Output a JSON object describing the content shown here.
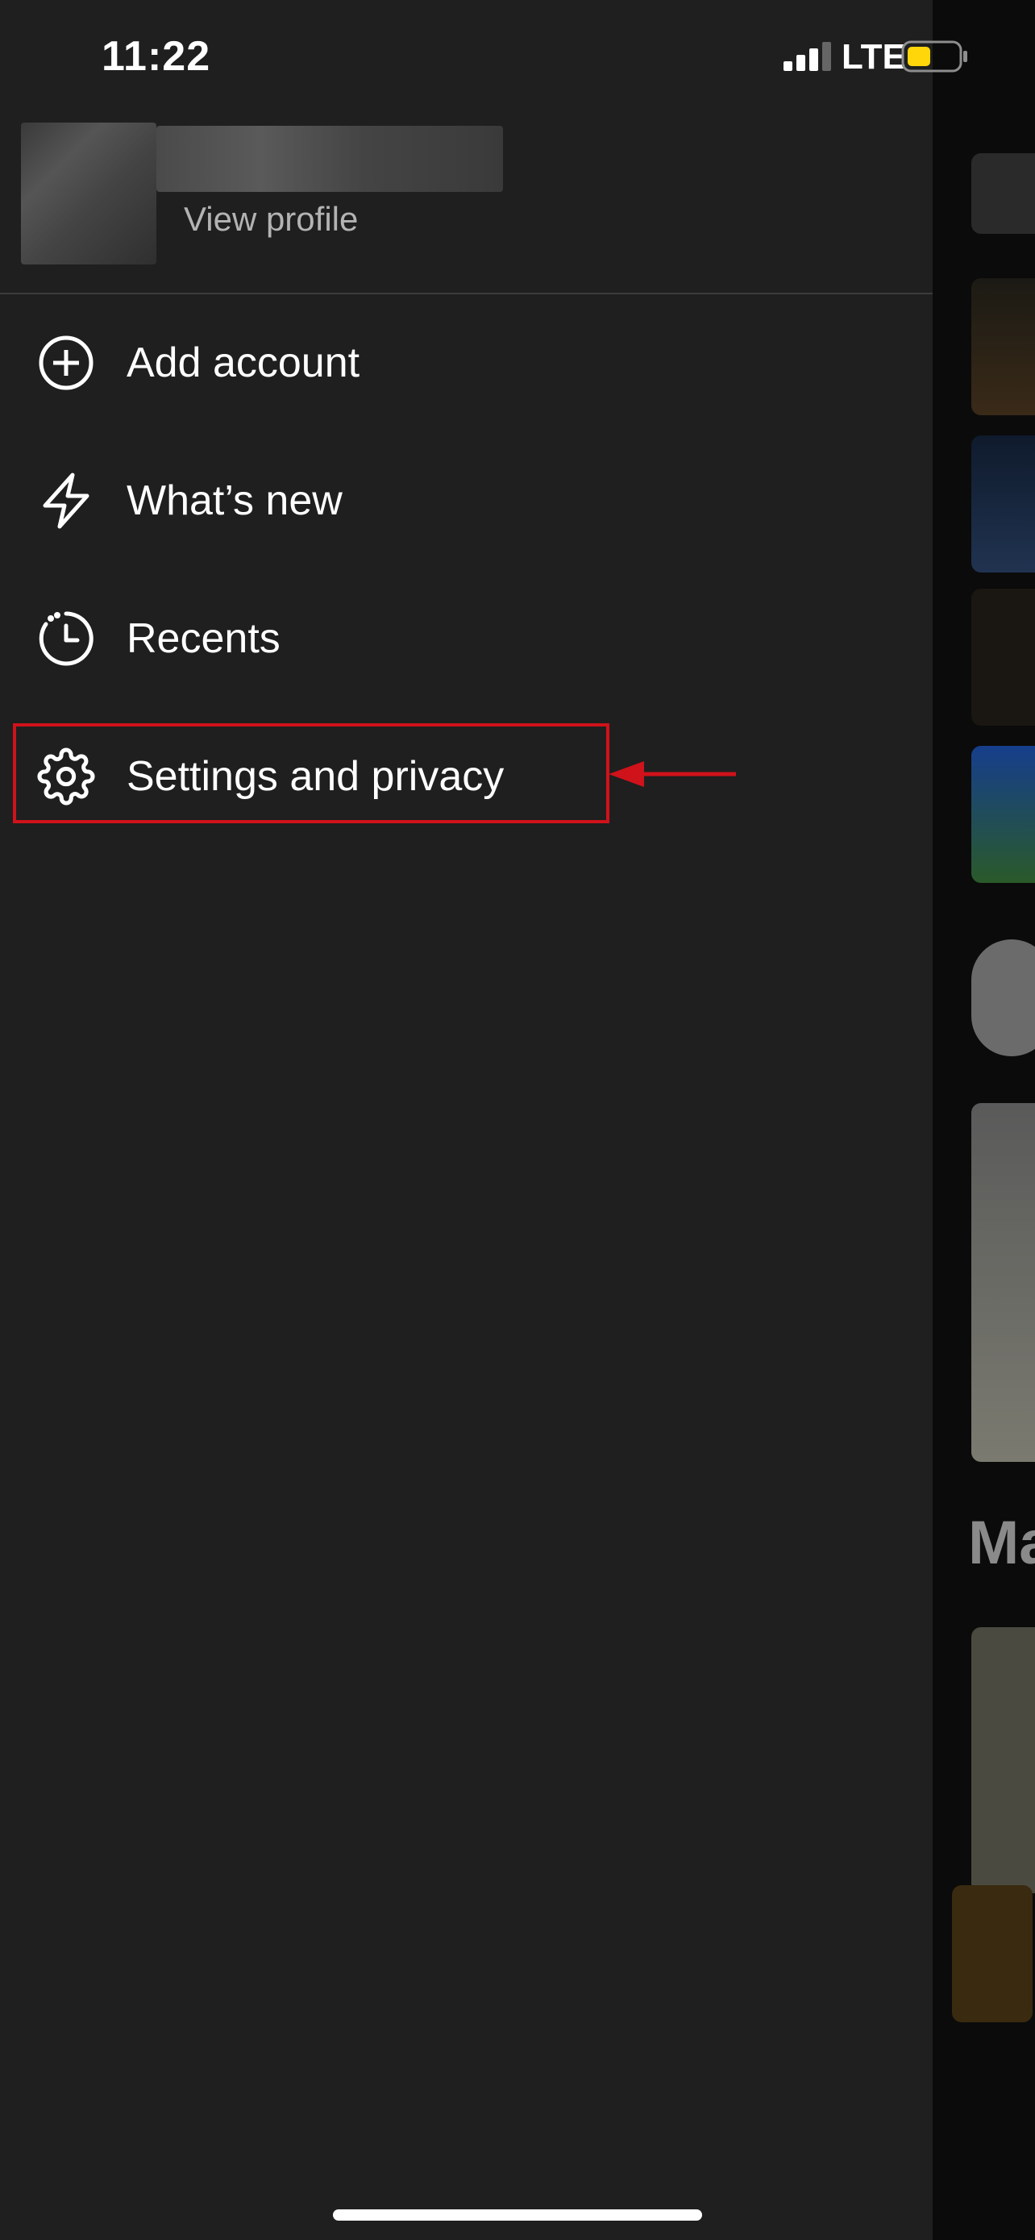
{
  "status": {
    "time": "11:22",
    "network": "LTE"
  },
  "profile": {
    "view_profile_label": "View profile"
  },
  "menu": {
    "items": [
      {
        "label": "Add account",
        "icon": "plus-circle-icon"
      },
      {
        "label": "What’s new",
        "icon": "lightning-icon"
      },
      {
        "label": "Recents",
        "icon": "clock-history-icon"
      },
      {
        "label": "Settings and privacy",
        "icon": "gear-icon"
      }
    ]
  },
  "background": {
    "section_fragment": "Ma"
  },
  "colors": {
    "background": "#1f1f1f",
    "highlight": "#d0121b",
    "battery": "#ffd60a"
  }
}
